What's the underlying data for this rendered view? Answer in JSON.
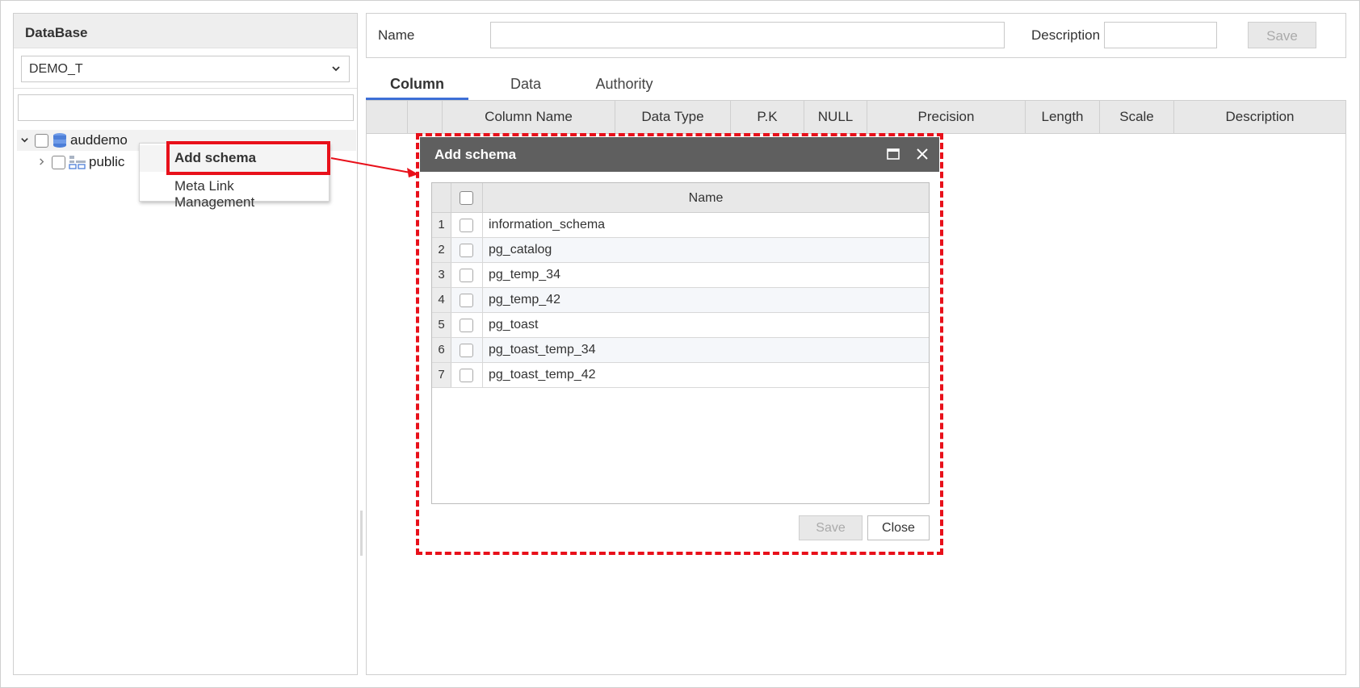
{
  "database_panel": {
    "title": "DataBase",
    "selected_database": "DEMO_T",
    "tree_search_value": "",
    "tree": {
      "root_label": "auddemo",
      "child_label": "public"
    }
  },
  "context_menu": {
    "items": [
      "Add schema",
      "Meta Link Management"
    ]
  },
  "form": {
    "name_label": "Name",
    "name_value": "",
    "description_label": "Description",
    "description_value": "",
    "save_label": "Save"
  },
  "tabs": [
    "Column",
    "Data",
    "Authority"
  ],
  "active_tab": "Column",
  "columns_table": {
    "headers": [
      "Column Name",
      "Data Type",
      "P.K",
      "NULL",
      "Precision",
      "Length",
      "Scale",
      "Description"
    ]
  },
  "modal": {
    "title": "Add schema",
    "grid_header": "Name",
    "rows": [
      {
        "num": "1",
        "name": "information_schema"
      },
      {
        "num": "2",
        "name": "pg_catalog"
      },
      {
        "num": "3",
        "name": "pg_temp_34"
      },
      {
        "num": "4",
        "name": "pg_temp_42"
      },
      {
        "num": "5",
        "name": "pg_toast"
      },
      {
        "num": "6",
        "name": "pg_toast_temp_34"
      },
      {
        "num": "7",
        "name": "pg_toast_temp_42"
      }
    ],
    "save_label": "Save",
    "close_label": "Close"
  },
  "colors": {
    "annotation_red": "#e8101a",
    "modal_title_bar": "#5f5f5f",
    "active_tab_underline": "#3d6fd6"
  }
}
